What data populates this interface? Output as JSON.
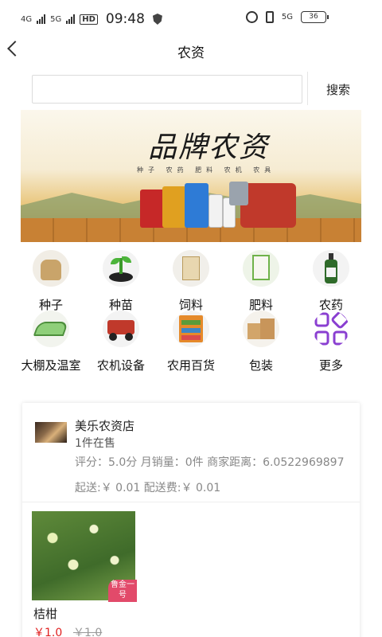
{
  "status_bar": {
    "network_1": "4G",
    "network_2": "5G",
    "hd": "HD",
    "time": "09:48",
    "network_right": "5G",
    "battery": "36"
  },
  "nav": {
    "title": "农资"
  },
  "search": {
    "value": "",
    "placeholder": "",
    "button_label": "搜索"
  },
  "banner": {
    "title": "品牌农资",
    "subtitle": "种子 农药 肥料 农机 农具"
  },
  "categories": [
    {
      "label": "种子",
      "icon": "seed-sack-icon"
    },
    {
      "label": "种苗",
      "icon": "seedling-icon"
    },
    {
      "label": "饲料",
      "icon": "feed-bag-icon"
    },
    {
      "label": "肥料",
      "icon": "fertilizer-bag-icon"
    },
    {
      "label": "农药",
      "icon": "pesticide-bottle-icon"
    },
    {
      "label": "大棚及温室",
      "icon": "greenhouse-icon"
    },
    {
      "label": "农机设备",
      "icon": "tractor-icon"
    },
    {
      "label": "农用百货",
      "icon": "general-store-icon"
    },
    {
      "label": "包装",
      "icon": "cardboard-box-icon"
    },
    {
      "label": "更多",
      "icon": "more-grid-icon"
    }
  ],
  "shop": {
    "name": "美乐农资店",
    "count": "1件在售",
    "stats": "评分：5.0分    月销量：0件    商家距离：6.0522969897",
    "fees": "起送:￥ 0.01          配送费:￥ 0.01"
  },
  "product": {
    "badge": "鲁金一号",
    "name": "桔柑",
    "price": "￥1.0",
    "old_price": "￥1.0"
  },
  "colors": {
    "price": "#e02020",
    "accent_more": "#8a3fd1"
  }
}
